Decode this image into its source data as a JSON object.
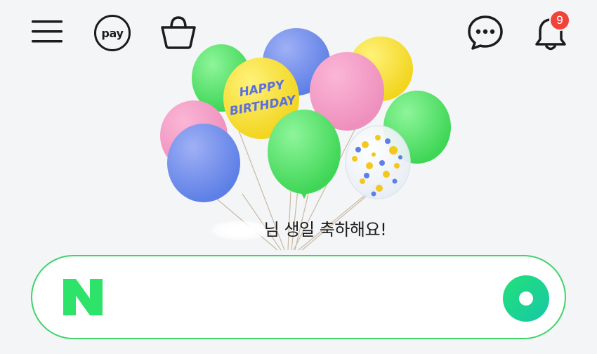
{
  "header": {
    "menu_icon": "hamburger-menu-icon",
    "pay_label": "pay",
    "bag_icon": "shopping-bag-icon",
    "chat_icon": "chat-bubble-icon",
    "bell_icon": "bell-icon",
    "notification_count": "9"
  },
  "banner": {
    "balloon_text": "HAPPY BIRTHDAY",
    "balloon_text_line1": "HAPPY",
    "balloon_text_line2": "BIRTHDAY",
    "message": "님 생일 축하해요!"
  },
  "search": {
    "logo_letter": "N",
    "value": "",
    "placeholder": ""
  },
  "colors": {
    "background": "#f4f5f7",
    "brand_green": "#03c75a",
    "search_border": "#3fd46a",
    "badge_red": "#f0433a"
  }
}
